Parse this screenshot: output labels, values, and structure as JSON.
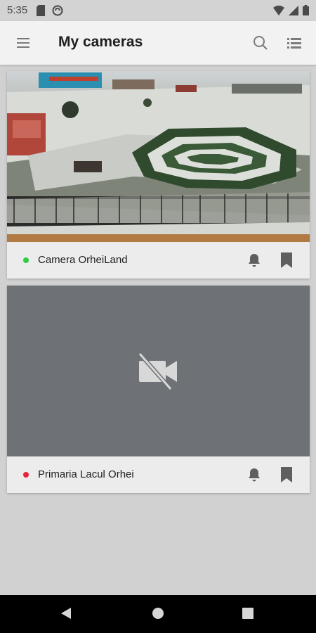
{
  "status_bar": {
    "time": "5:35"
  },
  "app_bar": {
    "title": "My cameras"
  },
  "cameras": [
    {
      "name": "Camera OrheiLand",
      "status": "online",
      "status_color": "#2ecc40"
    },
    {
      "name": "Primaria Lacul Orhei",
      "status": "offline",
      "status_color": "#e8243c"
    }
  ],
  "icons": {
    "menu": "hamburger-menu-icon",
    "search": "search-icon",
    "list": "list-view-icon",
    "bell": "bell-icon",
    "bookmark": "bookmark-icon",
    "no_video": "video-off-icon"
  },
  "colors": {
    "offline_thumb": "#6e7276",
    "card": "#ececec",
    "app_bar": "#f2f2f2"
  }
}
